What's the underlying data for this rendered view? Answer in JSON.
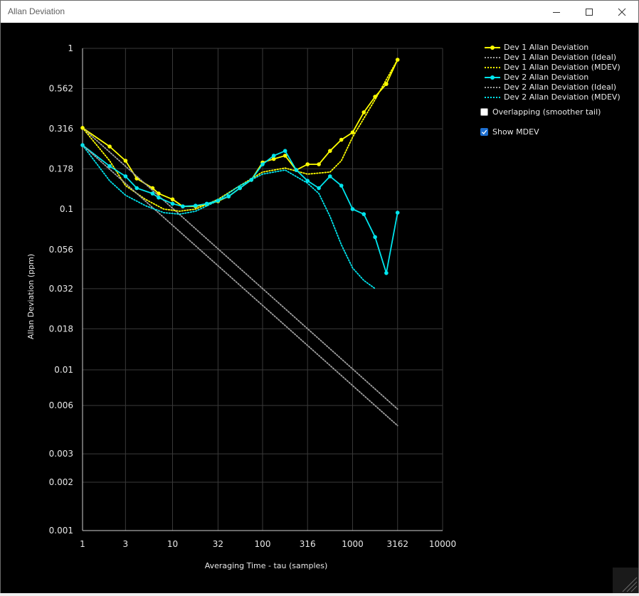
{
  "window": {
    "title": "Allan Deviation"
  },
  "controls": {
    "overlapping_label": "Overlapping (smoother tail)",
    "overlapping_checked": false,
    "mdev_label": "Show MDEV",
    "mdev_checked": true
  },
  "colors": {
    "dev1": "#ffff00",
    "dev2": "#00e5ee",
    "ideal": "#a0a0a0",
    "grid": "#3a3a3a",
    "axis": "#cfcfcf"
  },
  "chart_data": {
    "type": "line",
    "xlabel": "Averaging Time - tau (samples)",
    "ylabel": "Allan Deviation (ppm)",
    "x_scale": "log",
    "y_scale": "log",
    "xlim": [
      1,
      10000
    ],
    "ylim": [
      0.001,
      1
    ],
    "grid": true,
    "legend_position": "top-right",
    "x_ticks": [
      "1",
      "3",
      "10",
      "32",
      "100",
      "316",
      "1000",
      "3162",
      "10000"
    ],
    "y_ticks": [
      "1",
      "0.562",
      "0.316",
      "0.178",
      "0.1",
      "0.056",
      "0.032",
      "0.018",
      "0.01",
      "0.006",
      "0.003",
      "0.002",
      "0.001"
    ],
    "series": [
      {
        "name": "Dev 1 Allan Deviation",
        "style": "solid-markers",
        "color": "#ffff00",
        "x": [
          1,
          2,
          3,
          4,
          6,
          7,
          10,
          13,
          18,
          24,
          32,
          42,
          56,
          75,
          100,
          133,
          178,
          237,
          316,
          422,
          562,
          750,
          1000,
          1334,
          1778,
          2371,
          3162
        ],
        "y": [
          0.32,
          0.245,
          0.2,
          0.155,
          0.135,
          0.125,
          0.115,
          0.104,
          0.104,
          0.107,
          0.112,
          0.12,
          0.135,
          0.152,
          0.195,
          0.205,
          0.215,
          0.175,
          0.19,
          0.19,
          0.23,
          0.27,
          0.3,
          0.4,
          0.5,
          0.6,
          0.85
        ]
      },
      {
        "name": "Dev 1 Allan Deviation (Ideal)",
        "style": "dotted",
        "color": "#a0a0a0",
        "x": [
          1,
          3162
        ],
        "y": [
          0.32,
          0.0057
        ]
      },
      {
        "name": "Dev 1 Allan Deviation (MDEV)",
        "style": "dotted",
        "color": "#ffff00",
        "x": [
          1,
          2,
          3,
          5,
          8,
          12,
          18,
          32,
          56,
          100,
          178,
          316,
          562,
          750,
          1000,
          1778,
          3162
        ],
        "y": [
          0.32,
          0.2,
          0.14,
          0.115,
          0.1,
          0.097,
          0.1,
          0.115,
          0.14,
          0.17,
          0.18,
          0.165,
          0.17,
          0.2,
          0.28,
          0.48,
          0.85
        ]
      },
      {
        "name": "Dev 2 Allan Deviation",
        "style": "solid-markers",
        "color": "#00e5ee",
        "x": [
          1,
          2,
          3,
          4,
          6,
          7,
          10,
          13,
          18,
          24,
          32,
          42,
          56,
          75,
          100,
          133,
          178,
          237,
          316,
          422,
          562,
          750,
          1000,
          1334,
          1778,
          2371,
          3162
        ],
        "y": [
          0.25,
          0.185,
          0.16,
          0.135,
          0.125,
          0.118,
          0.108,
          0.104,
          0.105,
          0.108,
          0.113,
          0.12,
          0.135,
          0.152,
          0.19,
          0.215,
          0.23,
          0.175,
          0.15,
          0.135,
          0.16,
          0.14,
          0.1,
          0.093,
          0.067,
          0.04,
          0.095
        ]
      },
      {
        "name": "Dev 2 Allan Deviation (Ideal)",
        "style": "dotted",
        "color": "#a0a0a0",
        "x": [
          1,
          3162
        ],
        "y": [
          0.25,
          0.0045
        ]
      },
      {
        "name": "Dev 2 Allan Deviation (MDEV)",
        "style": "dotted",
        "color": "#00e5ee",
        "x": [
          1,
          2,
          3,
          5,
          8,
          12,
          18,
          32,
          56,
          100,
          178,
          316,
          422,
          562,
          750,
          1000,
          1334,
          1778
        ],
        "y": [
          0.25,
          0.15,
          0.122,
          0.105,
          0.095,
          0.093,
          0.097,
          0.113,
          0.14,
          0.165,
          0.175,
          0.145,
          0.125,
          0.09,
          0.06,
          0.043,
          0.036,
          0.032
        ]
      }
    ]
  }
}
